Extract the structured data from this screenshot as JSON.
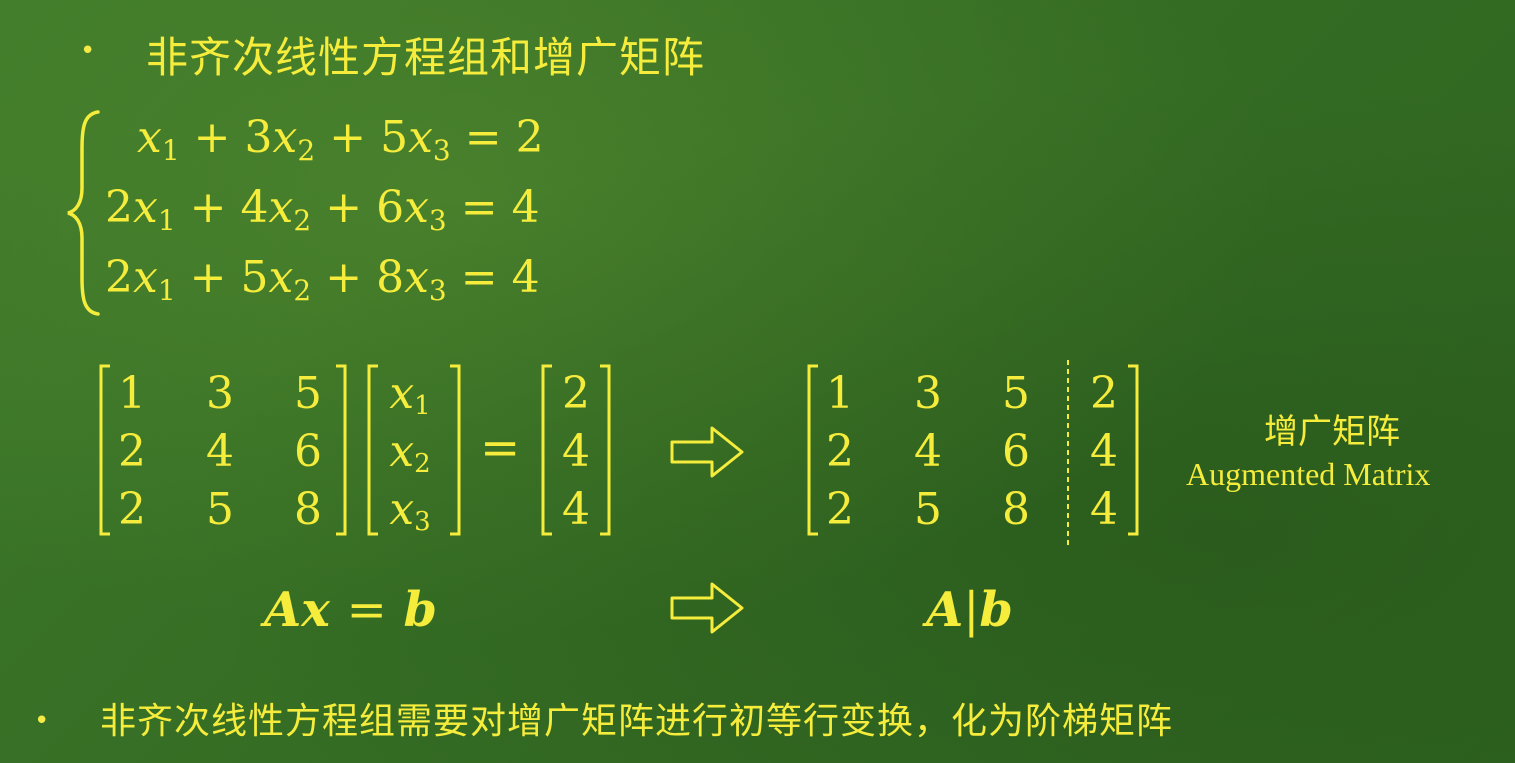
{
  "heading": {
    "bullet": "•",
    "text": "非齐次线性方程组和增广矩阵"
  },
  "equations": [
    {
      "c1": "",
      "c2": "3",
      "c3": "5",
      "rhs": "2"
    },
    {
      "c1": "2",
      "c2": "4",
      "c3": "6",
      "rhs": "4"
    },
    {
      "c1": "2",
      "c2": "5",
      "c3": "8",
      "rhs": "4"
    }
  ],
  "symbols": {
    "plus": "+",
    "equals": "=",
    "x": "x",
    "s1": "1",
    "s2": "2",
    "s3": "3"
  },
  "matrix_A": [
    [
      "1",
      "3",
      "5"
    ],
    [
      "2",
      "4",
      "6"
    ],
    [
      "2",
      "5",
      "8"
    ]
  ],
  "vector_b": [
    "2",
    "4",
    "4"
  ],
  "augmented": [
    [
      "1",
      "3",
      "5",
      "2"
    ],
    [
      "2",
      "4",
      "6",
      "4"
    ],
    [
      "2",
      "5",
      "8",
      "4"
    ]
  ],
  "augmented_label": {
    "cn": "增广矩阵",
    "en": "Augmented Matrix"
  },
  "formulas": {
    "ax_a": "A",
    "ax_x": "x",
    "ax_eq": "=",
    "ax_b": "b",
    "ab_a": "A",
    "ab_bar": "|",
    "ab_b": "b"
  },
  "bottom": {
    "bullet": "•",
    "text": "非齐次线性方程组需要对增广矩阵进行初等行变换，化为阶梯矩阵"
  },
  "colors": {
    "text": "#f5ec3c",
    "board": "#3a7326"
  }
}
